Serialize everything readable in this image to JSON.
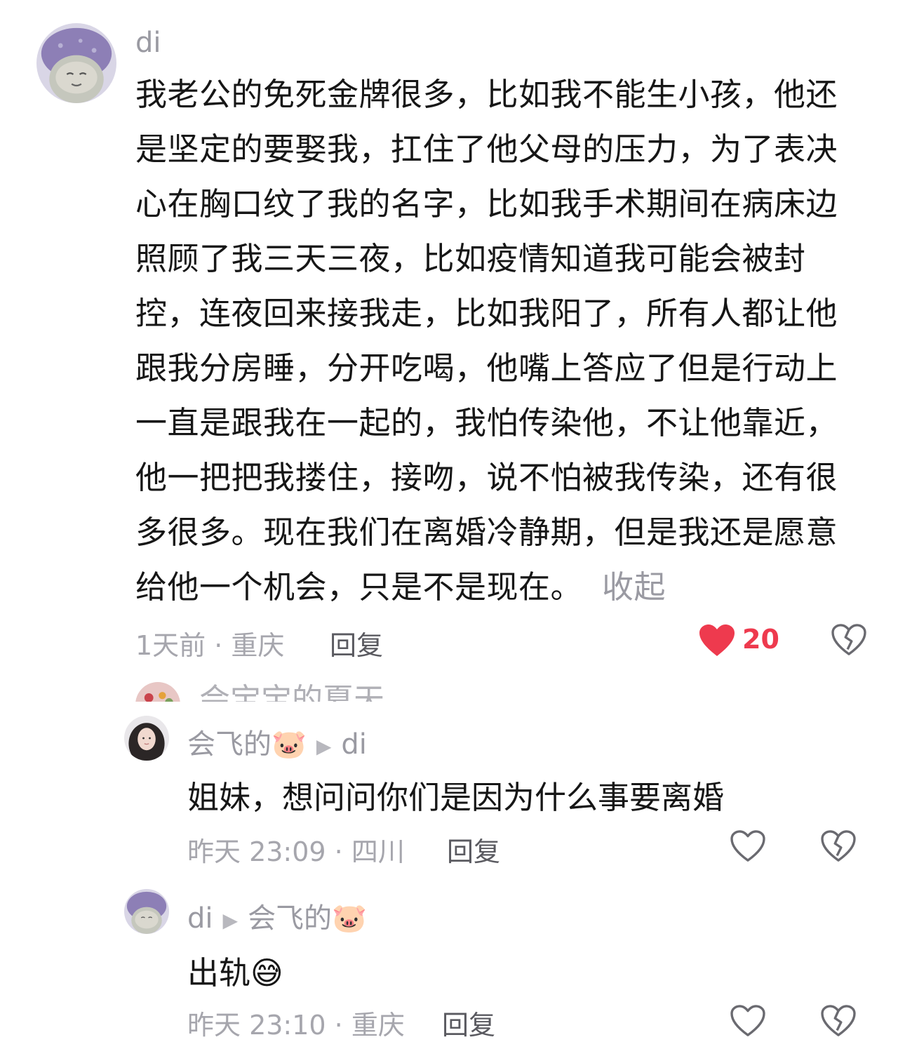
{
  "comment": {
    "username": "di",
    "lines": [
      "我老公的免死金牌很多，比如我不能生小孩，他还",
      "是坚定的要娶我，扛住了他父母的压力，为了表决",
      "心在胸口纹了我的名字，比如我手术期间在病床边",
      "照顾了我三天三夜，比如疫情知道我可能会被封",
      "控，连夜回来接我走，比如我阳了，所有人都让他",
      "跟我分房睡，分开吃喝，他嘴上答应了但是行动上",
      "一直是跟我在一起的，我怕传染他，不让他靠近，",
      "他一把把我搂住，接吻，说不怕被我传染，还有很",
      "多很多。现在我们在离婚冷静期，但是我还是愿意",
      "给他一个机会，只是不是现在。"
    ],
    "collapse_label": "收起",
    "time_location": "1天前 · 重庆",
    "reply_label": "回复",
    "like_count": "20"
  },
  "peek": {
    "username": "会宝宝的夏天"
  },
  "reply1": {
    "username": "会飞的🐷",
    "reply_to": "di",
    "text": "姐妹，想问问你们是因为什么事要离婚",
    "time_location": "昨天 23:09 · 四川",
    "reply_label": "回复"
  },
  "reply2": {
    "username": "di",
    "reply_to": "会飞的🐷",
    "text": "出轨😅",
    "time_location": "昨天 23:10 · 重庆",
    "reply_label": "回复"
  },
  "colors": {
    "like_red": "#ee3a4e",
    "meta_gray": "#a6a6ad",
    "text_dark": "#161616"
  },
  "icons": [
    "heart-filled-icon",
    "heart-outline-icon",
    "broken-heart-icon",
    "play-arrow-icon"
  ]
}
